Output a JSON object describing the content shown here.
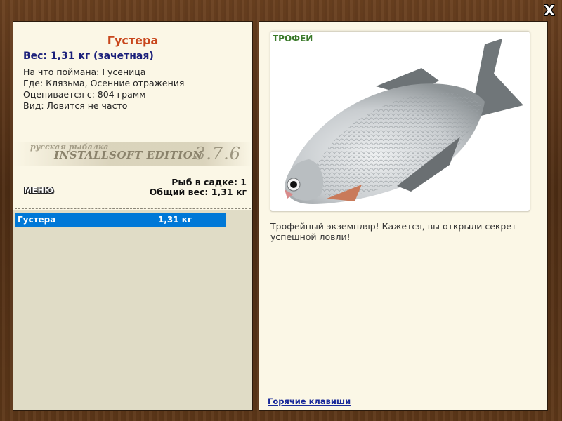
{
  "window": {
    "close_glyph": "X"
  },
  "fish": {
    "name": "Густера",
    "weight_line": "Вес: 1,31 кг (зачетная)",
    "bait_line": "На что поймана: Гусеница",
    "place_line": "Где: Клязьма, Осенние отражения",
    "value_line": "Оценивается с: 804 грамм",
    "view_line": "Вид: Ловится не часто"
  },
  "logo": {
    "small": "русская рыбалка",
    "big": "INSTALLSOFT EDITION",
    "version": "3.7.6"
  },
  "menu_label": "МЕНЮ",
  "sadok": {
    "count_line": "Рыб в садке: 1",
    "weight_line": "Общий вес: 1,31 кг"
  },
  "catch_list": [
    {
      "name": "Густера",
      "weight": "1,31 кг",
      "selected": true
    }
  ],
  "trophy": {
    "label": "ТРОФЕЙ",
    "description": "Трофейный экземпляр! Кажется, вы открыли секрет успешной ловли!"
  },
  "hotkeys_link": "Горячие клавиши",
  "colors": {
    "title": "#c8461c",
    "weight": "#1a1f7a",
    "selection": "#0078d7",
    "trophy": "#3a7a2a",
    "link": "#1a2a9a",
    "panel": "#fbf7e6",
    "wood": "#5a3519"
  }
}
